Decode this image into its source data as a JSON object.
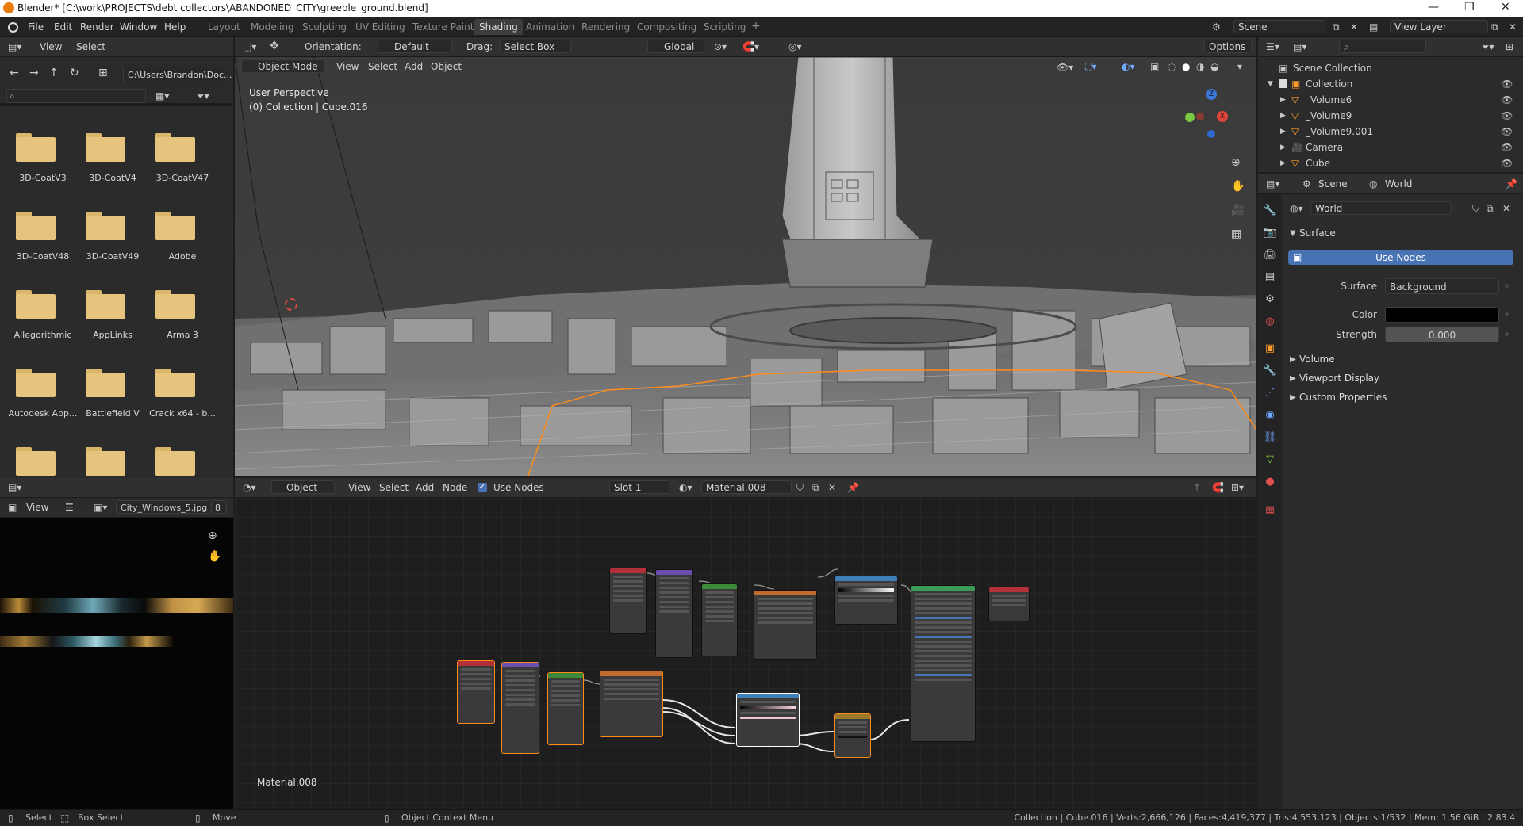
{
  "window": {
    "title": "Blender* [C:\\work\\PROJECTS\\debt collectors\\ABANDONED_CITY\\greeble_ground.blend]",
    "controls": [
      "—",
      "❐",
      "✕"
    ]
  },
  "menu": [
    "File",
    "Edit",
    "Render",
    "Window",
    "Help"
  ],
  "workspaces": [
    "Layout",
    "Modeling",
    "Sculpting",
    "UV Editing",
    "Texture Paint",
    "Shading",
    "Animation",
    "Rendering",
    "Compositing",
    "Scripting",
    "+"
  ],
  "active_workspace": "Shading",
  "scene": {
    "label": "Scene",
    "view_layer": "View Layer"
  },
  "file_browser": {
    "header": [
      "View",
      "Select"
    ],
    "path": "C:\\Users\\Brandon\\Doc...",
    "folders": [
      "3D-CoatV3",
      "3D-CoatV4",
      "3D-CoatV47",
      "3D-CoatV48",
      "3D-CoatV49",
      "Adobe",
      "Allegorithmic",
      "AppLinks",
      "Arma 3",
      "Autodesk App...",
      "Battlefield V",
      "Crack x64 - b...",
      "",
      "",
      ""
    ]
  },
  "viewport_tool_header": {
    "orientation_label": "Orientation:",
    "orientation_value": "Default",
    "drag_label": "Drag:",
    "drag_value": "Select Box",
    "transform": "Global",
    "options": "Options"
  },
  "viewport": {
    "mode": "Object Mode",
    "menus": [
      "View",
      "Select",
      "Add",
      "Object"
    ],
    "overlay_line1": "User Perspective",
    "overlay_line2": "(0) Collection | Cube.016",
    "gizmo_axes": [
      "Z",
      "Y",
      "X"
    ]
  },
  "node_editor": {
    "type": "Object",
    "menus": [
      "View",
      "Select",
      "Add",
      "Node"
    ],
    "use_nodes": "Use Nodes",
    "slot": "Slot 1",
    "material": "Material.008",
    "footer_label": "Material.008"
  },
  "image_editor": {
    "view": "View",
    "image": "City_Windows_5.jpg",
    "users": "8"
  },
  "outliner": {
    "root": "Scene Collection",
    "items": [
      {
        "name": "Collection",
        "level": 1
      },
      {
        "name": "_Volume6",
        "level": 2
      },
      {
        "name": "_Volume9",
        "level": 2
      },
      {
        "name": "_Volume9.001",
        "level": 2
      },
      {
        "name": "Camera",
        "level": 2
      },
      {
        "name": "Cube",
        "level": 2
      }
    ]
  },
  "properties": {
    "tabs": [
      "Scene",
      "World"
    ],
    "world_name": "World",
    "surface_section": "Surface",
    "use_nodes_button": "Use Nodes",
    "surface_label": "Surface",
    "surface_value": "Background",
    "color_label": "Color",
    "color_value": "#000000",
    "strength_label": "Strength",
    "strength_value": "0.000",
    "sections": [
      "Volume",
      "Viewport Display",
      "Custom Properties"
    ]
  },
  "statusbar": {
    "select": "Select",
    "box_select": "Box Select",
    "move": "Move",
    "context_menu": "Object Context Menu",
    "stats": "Collection | Cube.016 | Verts:2,666,126 | Faces:4,419,377 | Tris:4,553,123 | Objects:1/532 | Mem: 1.56 GiB | 2.83.4"
  },
  "colors": {
    "accent_blue": "#4772b3",
    "selection_orange": "#ff8c1a",
    "folder": "#e6c47d",
    "panel": "#2b2b2b",
    "header": "#303030"
  }
}
